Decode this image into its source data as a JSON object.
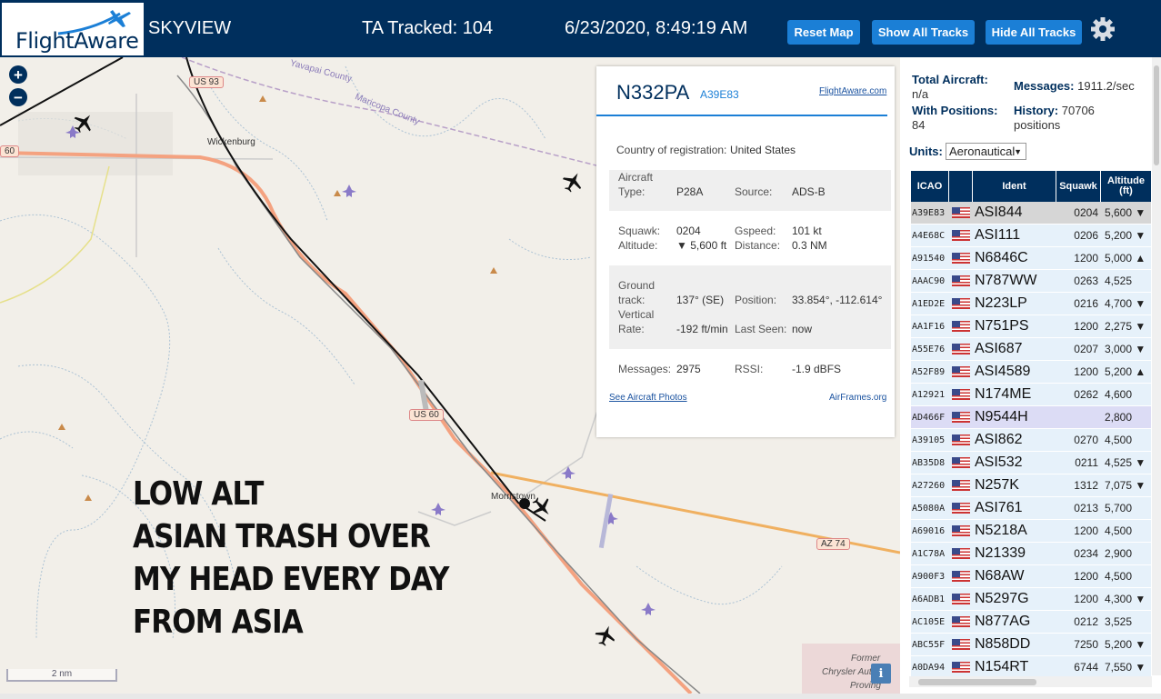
{
  "header": {
    "logo": "FlightAware",
    "site_name": "SKYVIEW",
    "ta_tracked": "TA Tracked: 104",
    "datetime": "6/23/2020, 8:49:19 AM",
    "buttons": {
      "reset": "Reset Map",
      "show_all": "Show All Tracks",
      "hide_all": "Hide All Tracks"
    }
  },
  "map": {
    "zoom_in": "+",
    "zoom_out": "−",
    "labels": {
      "yavapai": "Yavapai County",
      "maricopa": "Maricopa County",
      "wickenburg": "Wickenburg",
      "morristown": "Morristown",
      "former_line1": "Former",
      "former_line2": "Chrysler Auto",
      "former_line3": "Proving"
    },
    "shields": {
      "us93": "US 93",
      "us60_left": "60",
      "us60": "US 60",
      "az74": "AZ 74"
    },
    "scale": "2 nm",
    "info": "i",
    "overlay_lines": [
      "LOW ALT",
      "ASIAN TRASH OVER",
      "MY HEAD EVERY DAY",
      "FROM ASIA"
    ]
  },
  "popup": {
    "callsign": "N332PA",
    "hex": "A39E83",
    "fa_link": "FlightAware.com",
    "country_label": "Country of registration:",
    "country_value": "United States",
    "aircraft_type_label": "Aircraft\nType:",
    "aircraft_type_value": "P28A",
    "source_label": "Source:",
    "source_value": "ADS-B",
    "squawk_label": "Squawk:",
    "squawk_value": "0204",
    "gspeed_label": "Gspeed:",
    "gspeed_value": "101 kt",
    "altitude_label": "Altitude:",
    "altitude_value": "▼ 5,600 ft",
    "distance_label": "Distance:",
    "distance_value": "0.3 NM",
    "ground_track_label": "Ground\ntrack:",
    "ground_track_value": "137° (SE)",
    "position_label": "Position:",
    "position_value": "33.854°, -112.614°",
    "vertical_rate_label": "Vertical\nRate:",
    "vertical_rate_value": "-192 ft/min",
    "last_seen_label": "Last Seen:",
    "last_seen_value": "now",
    "messages_label": "Messages:",
    "messages_value": "2975",
    "rssi_label": "RSSI:",
    "rssi_value": "-1.9 dBFS",
    "photos_link": "See Aircraft Photos",
    "airframes_link": "AirFrames.org"
  },
  "stats": {
    "total_aircraft_label": "Total Aircraft:",
    "total_aircraft_value": "n/a",
    "messages_label": "Messages:",
    "messages_value": "1911.2/sec",
    "with_positions_label": "With Positions:",
    "with_positions_value": "84",
    "history_label": "History:",
    "history_value": "70706",
    "history_unit": "positions"
  },
  "units": {
    "label": "Units:",
    "value": "Aeronautical"
  },
  "table": {
    "headers": {
      "icao": "ICAO",
      "flag": "",
      "ident": "Ident",
      "squawk": "Squawk",
      "altitude": "Altitude\n(ft)"
    },
    "rows": [
      {
        "icao": "A39E83",
        "ident": "ASI844",
        "squawk": "0204",
        "altitude": "5,600 ▼"
      },
      {
        "icao": "A4E68C",
        "ident": "ASI111",
        "squawk": "0206",
        "altitude": "5,200 ▼"
      },
      {
        "icao": "A91540",
        "ident": "N6846C",
        "squawk": "1200",
        "altitude": "5,000 ▲"
      },
      {
        "icao": "AAAC90",
        "ident": "N787WW",
        "squawk": "0263",
        "altitude": "4,525"
      },
      {
        "icao": "A1ED2E",
        "ident": "N223LP",
        "squawk": "0216",
        "altitude": "4,700 ▼"
      },
      {
        "icao": "AA1F16",
        "ident": "N751PS",
        "squawk": "1200",
        "altitude": "2,275 ▼"
      },
      {
        "icao": "A55E76",
        "ident": "ASI687",
        "squawk": "0207",
        "altitude": "3,000 ▼"
      },
      {
        "icao": "A52F89",
        "ident": "ASI4589",
        "squawk": "1200",
        "altitude": "5,200 ▲"
      },
      {
        "icao": "A12921",
        "ident": "N174ME",
        "squawk": "0262",
        "altitude": "4,600"
      },
      {
        "icao": "AD466F",
        "ident": "N9544H",
        "squawk": "",
        "altitude": "2,800"
      },
      {
        "icao": "A39105",
        "ident": "ASI862",
        "squawk": "0270",
        "altitude": "4,500"
      },
      {
        "icao": "AB35D8",
        "ident": "ASI532",
        "squawk": "0211",
        "altitude": "4,525 ▼"
      },
      {
        "icao": "A27260",
        "ident": "N257K",
        "squawk": "1312",
        "altitude": "7,075 ▼"
      },
      {
        "icao": "A5080A",
        "ident": "ASI761",
        "squawk": "0213",
        "altitude": "5,700"
      },
      {
        "icao": "A69016",
        "ident": "N5218A",
        "squawk": "1200",
        "altitude": "4,500"
      },
      {
        "icao": "A1C78A",
        "ident": "N21339",
        "squawk": "0234",
        "altitude": "2,900"
      },
      {
        "icao": "A900F3",
        "ident": "N68AW",
        "squawk": "1200",
        "altitude": "4,500"
      },
      {
        "icao": "A6ADB1",
        "ident": "N5297G",
        "squawk": "1200",
        "altitude": "4,300 ▼"
      },
      {
        "icao": "AC105E",
        "ident": "N877AG",
        "squawk": "0212",
        "altitude": "3,525"
      },
      {
        "icao": "ABC55F",
        "ident": "N858DD",
        "squawk": "7250",
        "altitude": "5,200 ▼"
      },
      {
        "icao": "A0DA94",
        "ident": "N154RT",
        "squawk": "6744",
        "altitude": "7,550 ▼"
      }
    ]
  },
  "colors": {
    "header_bg": "#002f5d",
    "button_bg": "#1b7fd6",
    "map_bg": "#f2efe9",
    "road": "#f4a280",
    "highway": "#f0b060"
  }
}
